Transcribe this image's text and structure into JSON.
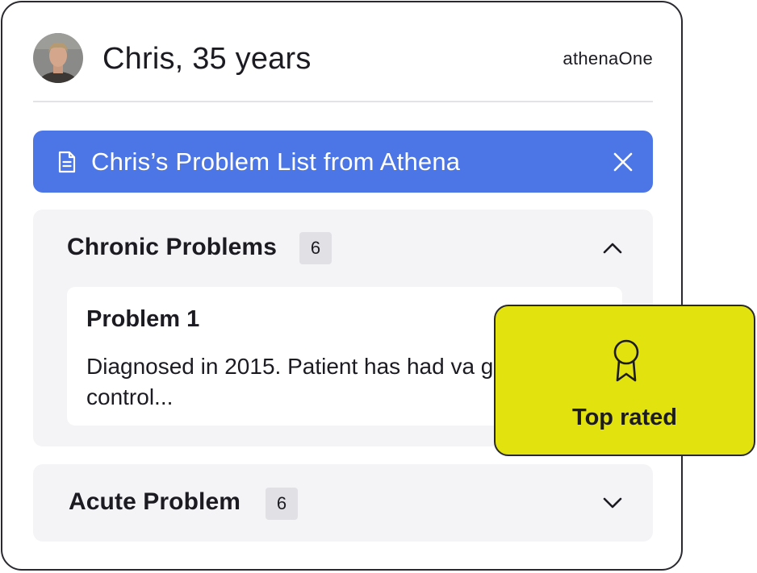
{
  "header": {
    "patient_name": "Chris, 35 years",
    "brand": "athenaOne"
  },
  "banner": {
    "title": "Chris’s Problem List from Athena",
    "icon": "document-icon",
    "close_icon": "close-icon",
    "color": "#4c75e6"
  },
  "sections": [
    {
      "title": "Chronic Problems",
      "count": "6",
      "state": "expanded",
      "chevron_icon": "chevron-up-icon",
      "problems": [
        {
          "title": "Problem 1",
          "description": "Diagnosed in 2015. Patient has had va glycemic control..."
        }
      ]
    },
    {
      "title": "Acute Problem",
      "count": "6",
      "state": "collapsed",
      "chevron_icon": "chevron-down-icon"
    }
  ],
  "badge": {
    "label": "Top rated",
    "icon": "award-ribbon-icon",
    "color": "#e2e20f"
  }
}
